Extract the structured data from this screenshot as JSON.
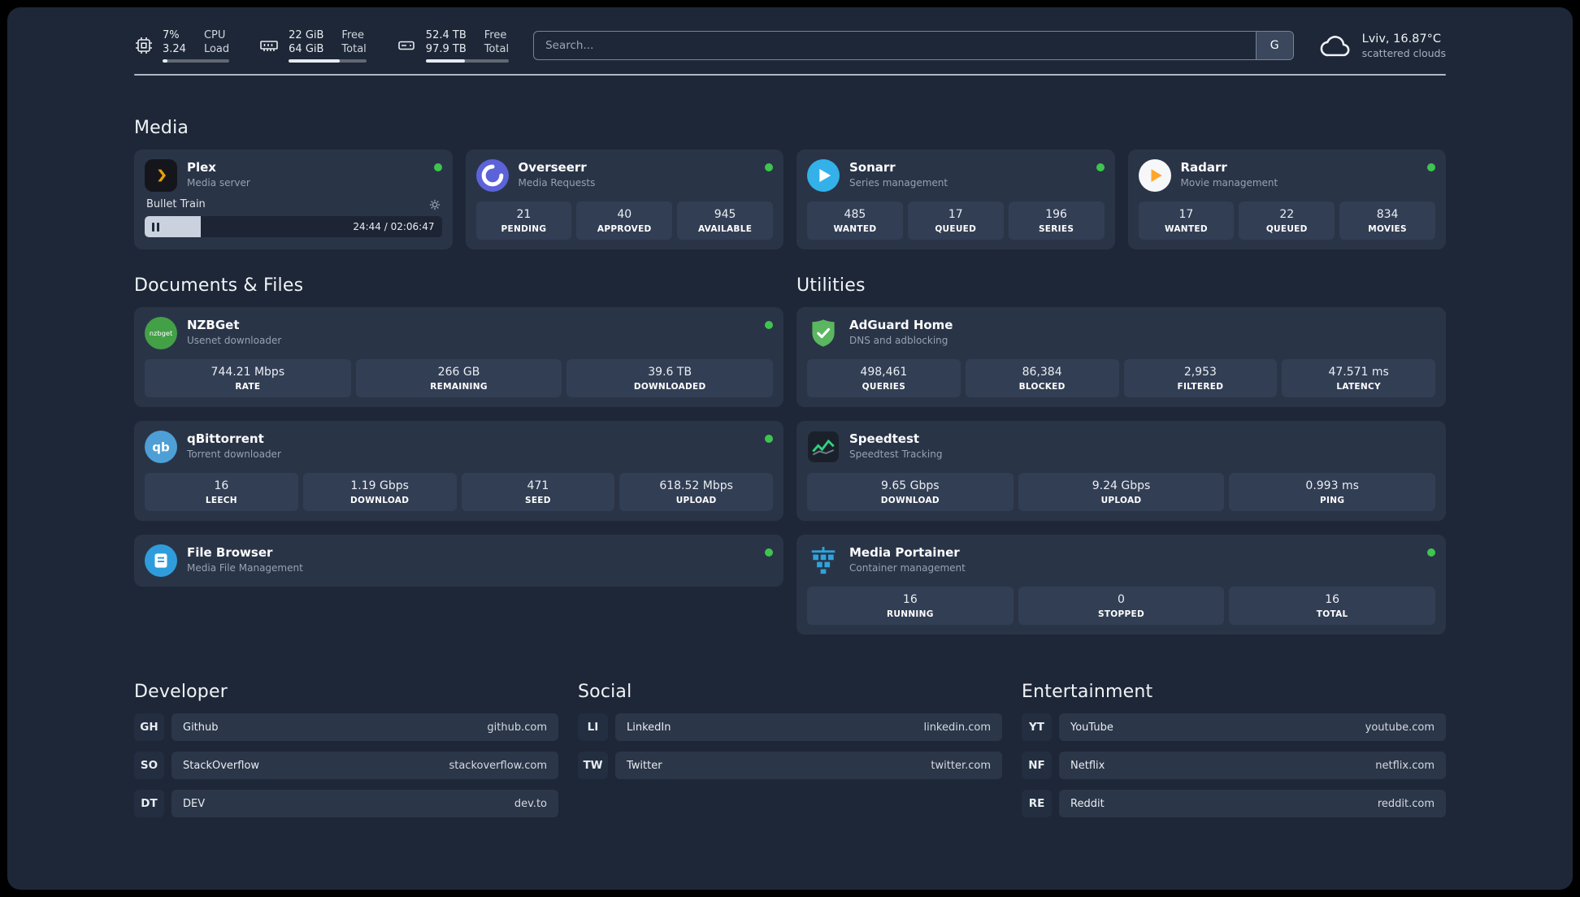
{
  "colors": {
    "background": "#1e2737",
    "card": "#2a3447",
    "stat_tile": "#323e54",
    "online_dot": "#3fc44f",
    "plex_accent": "#e5a00d",
    "adguard_green": "#5bb660",
    "portainer_blue": "#2ea4dd"
  },
  "topbar": {
    "cpu": {
      "icon": "cpu-chip-icon",
      "value_top": "7%",
      "value_bottom": "3.24",
      "label_top": "CPU",
      "label_bottom": "Load",
      "progress": 7
    },
    "ram": {
      "icon": "memory-icon",
      "value_top": "22 GiB",
      "value_bottom": "64 GiB",
      "label_top": "Free",
      "label_bottom": "Total",
      "progress": 66
    },
    "disk": {
      "icon": "hard-drive-icon",
      "value_top": "52.4 TB",
      "value_bottom": "97.9 TB",
      "label_top": "Free",
      "label_bottom": "Total",
      "progress": 47
    },
    "search": {
      "placeholder": "Search...",
      "engine_label": "G"
    },
    "weather": {
      "icon": "cloud-icon",
      "location": "Lviv, 16.87°C",
      "condition": "scattered clouds"
    }
  },
  "media": {
    "title": "Media",
    "plex": {
      "name": "Plex",
      "subtitle": "Media server",
      "now_playing": "Bullet Train",
      "time": "24:44 / 02:06:47",
      "progress_percent": 19
    },
    "overseerr": {
      "name": "Overseerr",
      "subtitle": "Media Requests",
      "stats": [
        {
          "value": "21",
          "label": "PENDING"
        },
        {
          "value": "40",
          "label": "APPROVED"
        },
        {
          "value": "945",
          "label": "AVAILABLE"
        }
      ]
    },
    "sonarr": {
      "name": "Sonarr",
      "subtitle": "Series management",
      "stats": [
        {
          "value": "485",
          "label": "WANTED"
        },
        {
          "value": "17",
          "label": "QUEUED"
        },
        {
          "value": "196",
          "label": "SERIES"
        }
      ]
    },
    "radarr": {
      "name": "Radarr",
      "subtitle": "Movie management",
      "stats": [
        {
          "value": "17",
          "label": "WANTED"
        },
        {
          "value": "22",
          "label": "QUEUED"
        },
        {
          "value": "834",
          "label": "MOVIES"
        }
      ]
    }
  },
  "documents": {
    "title": "Documents & Files",
    "nzbget": {
      "name": "NZBGet",
      "subtitle": "Usenet downloader",
      "icon_text": "nzbget",
      "stats": [
        {
          "value": "744.21 Mbps",
          "label": "RATE"
        },
        {
          "value": "266 GB",
          "label": "REMAINING"
        },
        {
          "value": "39.6 TB",
          "label": "DOWNLOADED"
        }
      ]
    },
    "qbittorrent": {
      "name": "qBittorrent",
      "subtitle": "Torrent downloader",
      "icon_text": "qb",
      "stats": [
        {
          "value": "16",
          "label": "LEECH"
        },
        {
          "value": "1.19 Gbps",
          "label": "DOWNLOAD"
        },
        {
          "value": "471",
          "label": "SEED"
        },
        {
          "value": "618.52 Mbps",
          "label": "UPLOAD"
        }
      ]
    },
    "filebrowser": {
      "name": "File Browser",
      "subtitle": "Media File Management"
    }
  },
  "utilities": {
    "title": "Utilities",
    "adguard": {
      "name": "AdGuard Home",
      "subtitle": "DNS and adblocking",
      "stats": [
        {
          "value": "498,461",
          "label": "QUERIES"
        },
        {
          "value": "86,384",
          "label": "BLOCKED"
        },
        {
          "value": "2,953",
          "label": "FILTERED"
        },
        {
          "value": "47.571 ms",
          "label": "LATENCY"
        }
      ]
    },
    "speedtest": {
      "name": "Speedtest",
      "subtitle": "Speedtest Tracking",
      "stats": [
        {
          "value": "9.65 Gbps",
          "label": "DOWNLOAD"
        },
        {
          "value": "9.24 Gbps",
          "label": "UPLOAD"
        },
        {
          "value": "0.993 ms",
          "label": "PING"
        }
      ]
    },
    "portainer": {
      "name": "Media Portainer",
      "subtitle": "Container management",
      "stats": [
        {
          "value": "16",
          "label": "RUNNING"
        },
        {
          "value": "0",
          "label": "STOPPED"
        },
        {
          "value": "16",
          "label": "TOTAL"
        }
      ]
    }
  },
  "bookmarks": {
    "developer": {
      "title": "Developer",
      "items": [
        {
          "abbr": "GH",
          "name": "Github",
          "url": "github.com"
        },
        {
          "abbr": "SO",
          "name": "StackOverflow",
          "url": "stackoverflow.com"
        },
        {
          "abbr": "DT",
          "name": "DEV",
          "url": "dev.to"
        }
      ]
    },
    "social": {
      "title": "Social",
      "items": [
        {
          "abbr": "LI",
          "name": "LinkedIn",
          "url": "linkedin.com"
        },
        {
          "abbr": "TW",
          "name": "Twitter",
          "url": "twitter.com"
        }
      ]
    },
    "entertainment": {
      "title": "Entertainment",
      "items": [
        {
          "abbr": "YT",
          "name": "YouTube",
          "url": "youtube.com"
        },
        {
          "abbr": "NF",
          "name": "Netflix",
          "url": "netflix.com"
        },
        {
          "abbr": "RE",
          "name": "Reddit",
          "url": "reddit.com"
        }
      ]
    }
  }
}
